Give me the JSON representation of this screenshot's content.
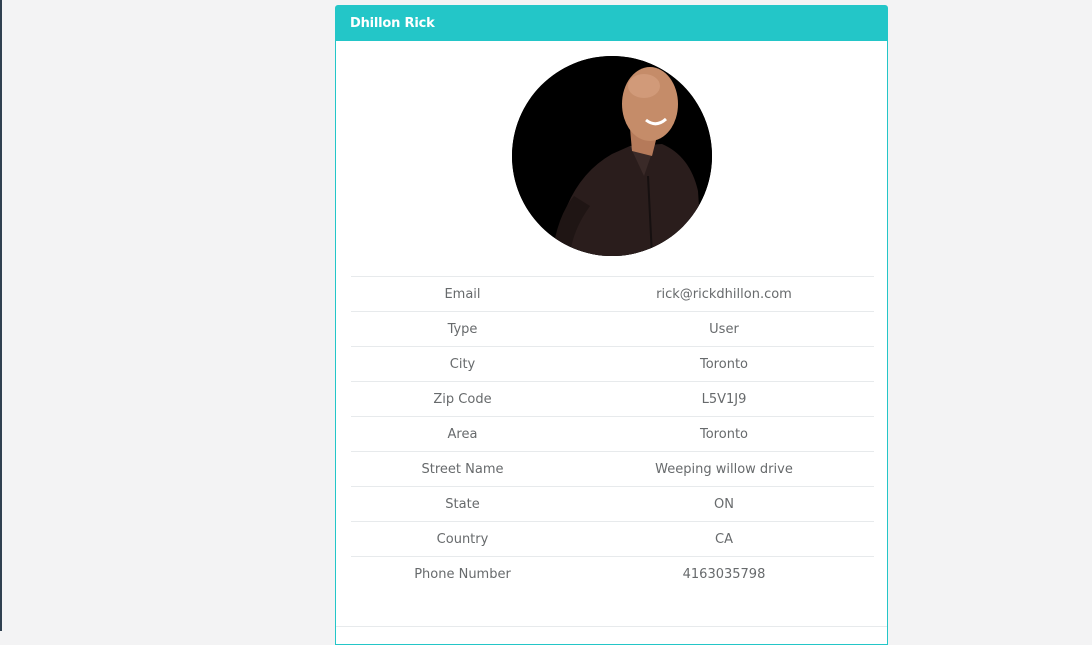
{
  "profile": {
    "name": "Dhillon Rick"
  },
  "avatar": {
    "icon": "user-photo"
  },
  "details": [
    {
      "label": "Email",
      "value": "rick@rickdhillon.com"
    },
    {
      "label": "Type",
      "value": "User"
    },
    {
      "label": "City",
      "value": "Toronto"
    },
    {
      "label": "Zip Code",
      "value": "L5V1J9"
    },
    {
      "label": "Area",
      "value": "Toronto"
    },
    {
      "label": "Street Name",
      "value": "Weeping willow drive"
    },
    {
      "label": "State",
      "value": "ON"
    },
    {
      "label": "Country",
      "value": "CA"
    },
    {
      "label": "Phone Number",
      "value": "4163035798"
    }
  ],
  "colors": {
    "header": "#23c6c8",
    "background": "#f3f3f4",
    "text": "#676a6c"
  }
}
